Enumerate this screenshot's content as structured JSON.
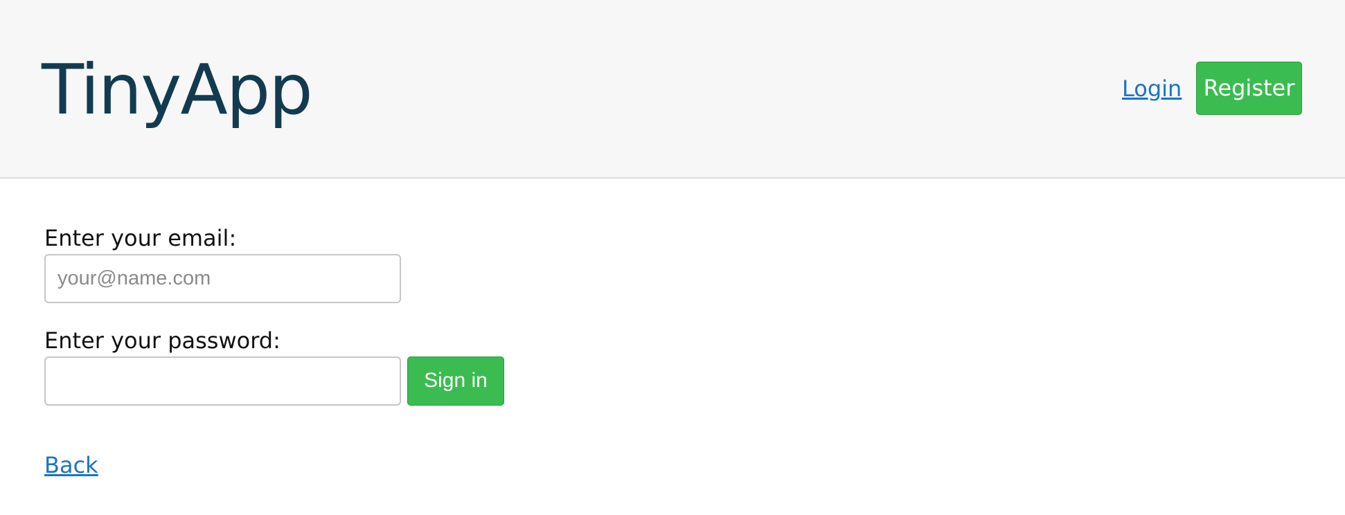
{
  "header": {
    "brand": "TinyApp",
    "login_label": "Login",
    "register_label": "Register"
  },
  "form": {
    "email_label": "Enter your email:",
    "email_placeholder": "your@name.com",
    "email_value": "",
    "password_label": "Enter your password:",
    "password_value": "",
    "signin_label": "Sign in"
  },
  "footer": {
    "back_label": "Back"
  },
  "colors": {
    "brand_text": "#133b50",
    "link": "#1a73c8",
    "button_green": "#3bbc50",
    "header_bg": "#f7f7f8"
  }
}
